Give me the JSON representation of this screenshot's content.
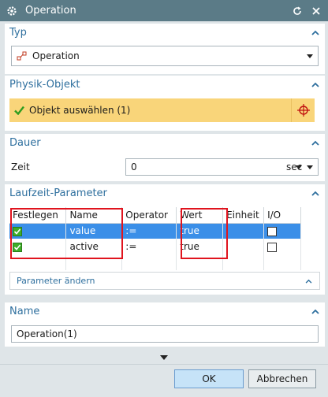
{
  "window": {
    "title": "Operation"
  },
  "typ": {
    "header": "Typ",
    "selected": "Operation"
  },
  "physik": {
    "header": "Physik-Objekt",
    "select_label": "Objekt auswählen (1)"
  },
  "dauer": {
    "header": "Dauer",
    "zeit_label": "Zeit",
    "zeit_value": "0",
    "unit": "sec"
  },
  "laufzeit": {
    "header": "Laufzeit-Parameter",
    "columns": [
      "Festlegen",
      "Name",
      "Operator",
      "Wert",
      "Einheit",
      "I/O"
    ],
    "rows": [
      {
        "festlegen": true,
        "name": "value",
        "operator": ":=",
        "wert": "true",
        "einheit": "",
        "io": false
      },
      {
        "festlegen": true,
        "name": "active",
        "operator": ":=",
        "wert": "true",
        "einheit": "",
        "io": false
      }
    ],
    "sub_header": "Parameter ändern"
  },
  "name_section": {
    "header": "Name",
    "value": "Operation(1)"
  },
  "buttons": {
    "ok": "OK",
    "cancel": "Abbrechen"
  },
  "colors": {
    "accent": "#2e6f9e",
    "title_bar": "#5b7b87",
    "selection": "#3b8fe8",
    "highlight": "#f9d57a",
    "annotation": "#e0141e"
  }
}
